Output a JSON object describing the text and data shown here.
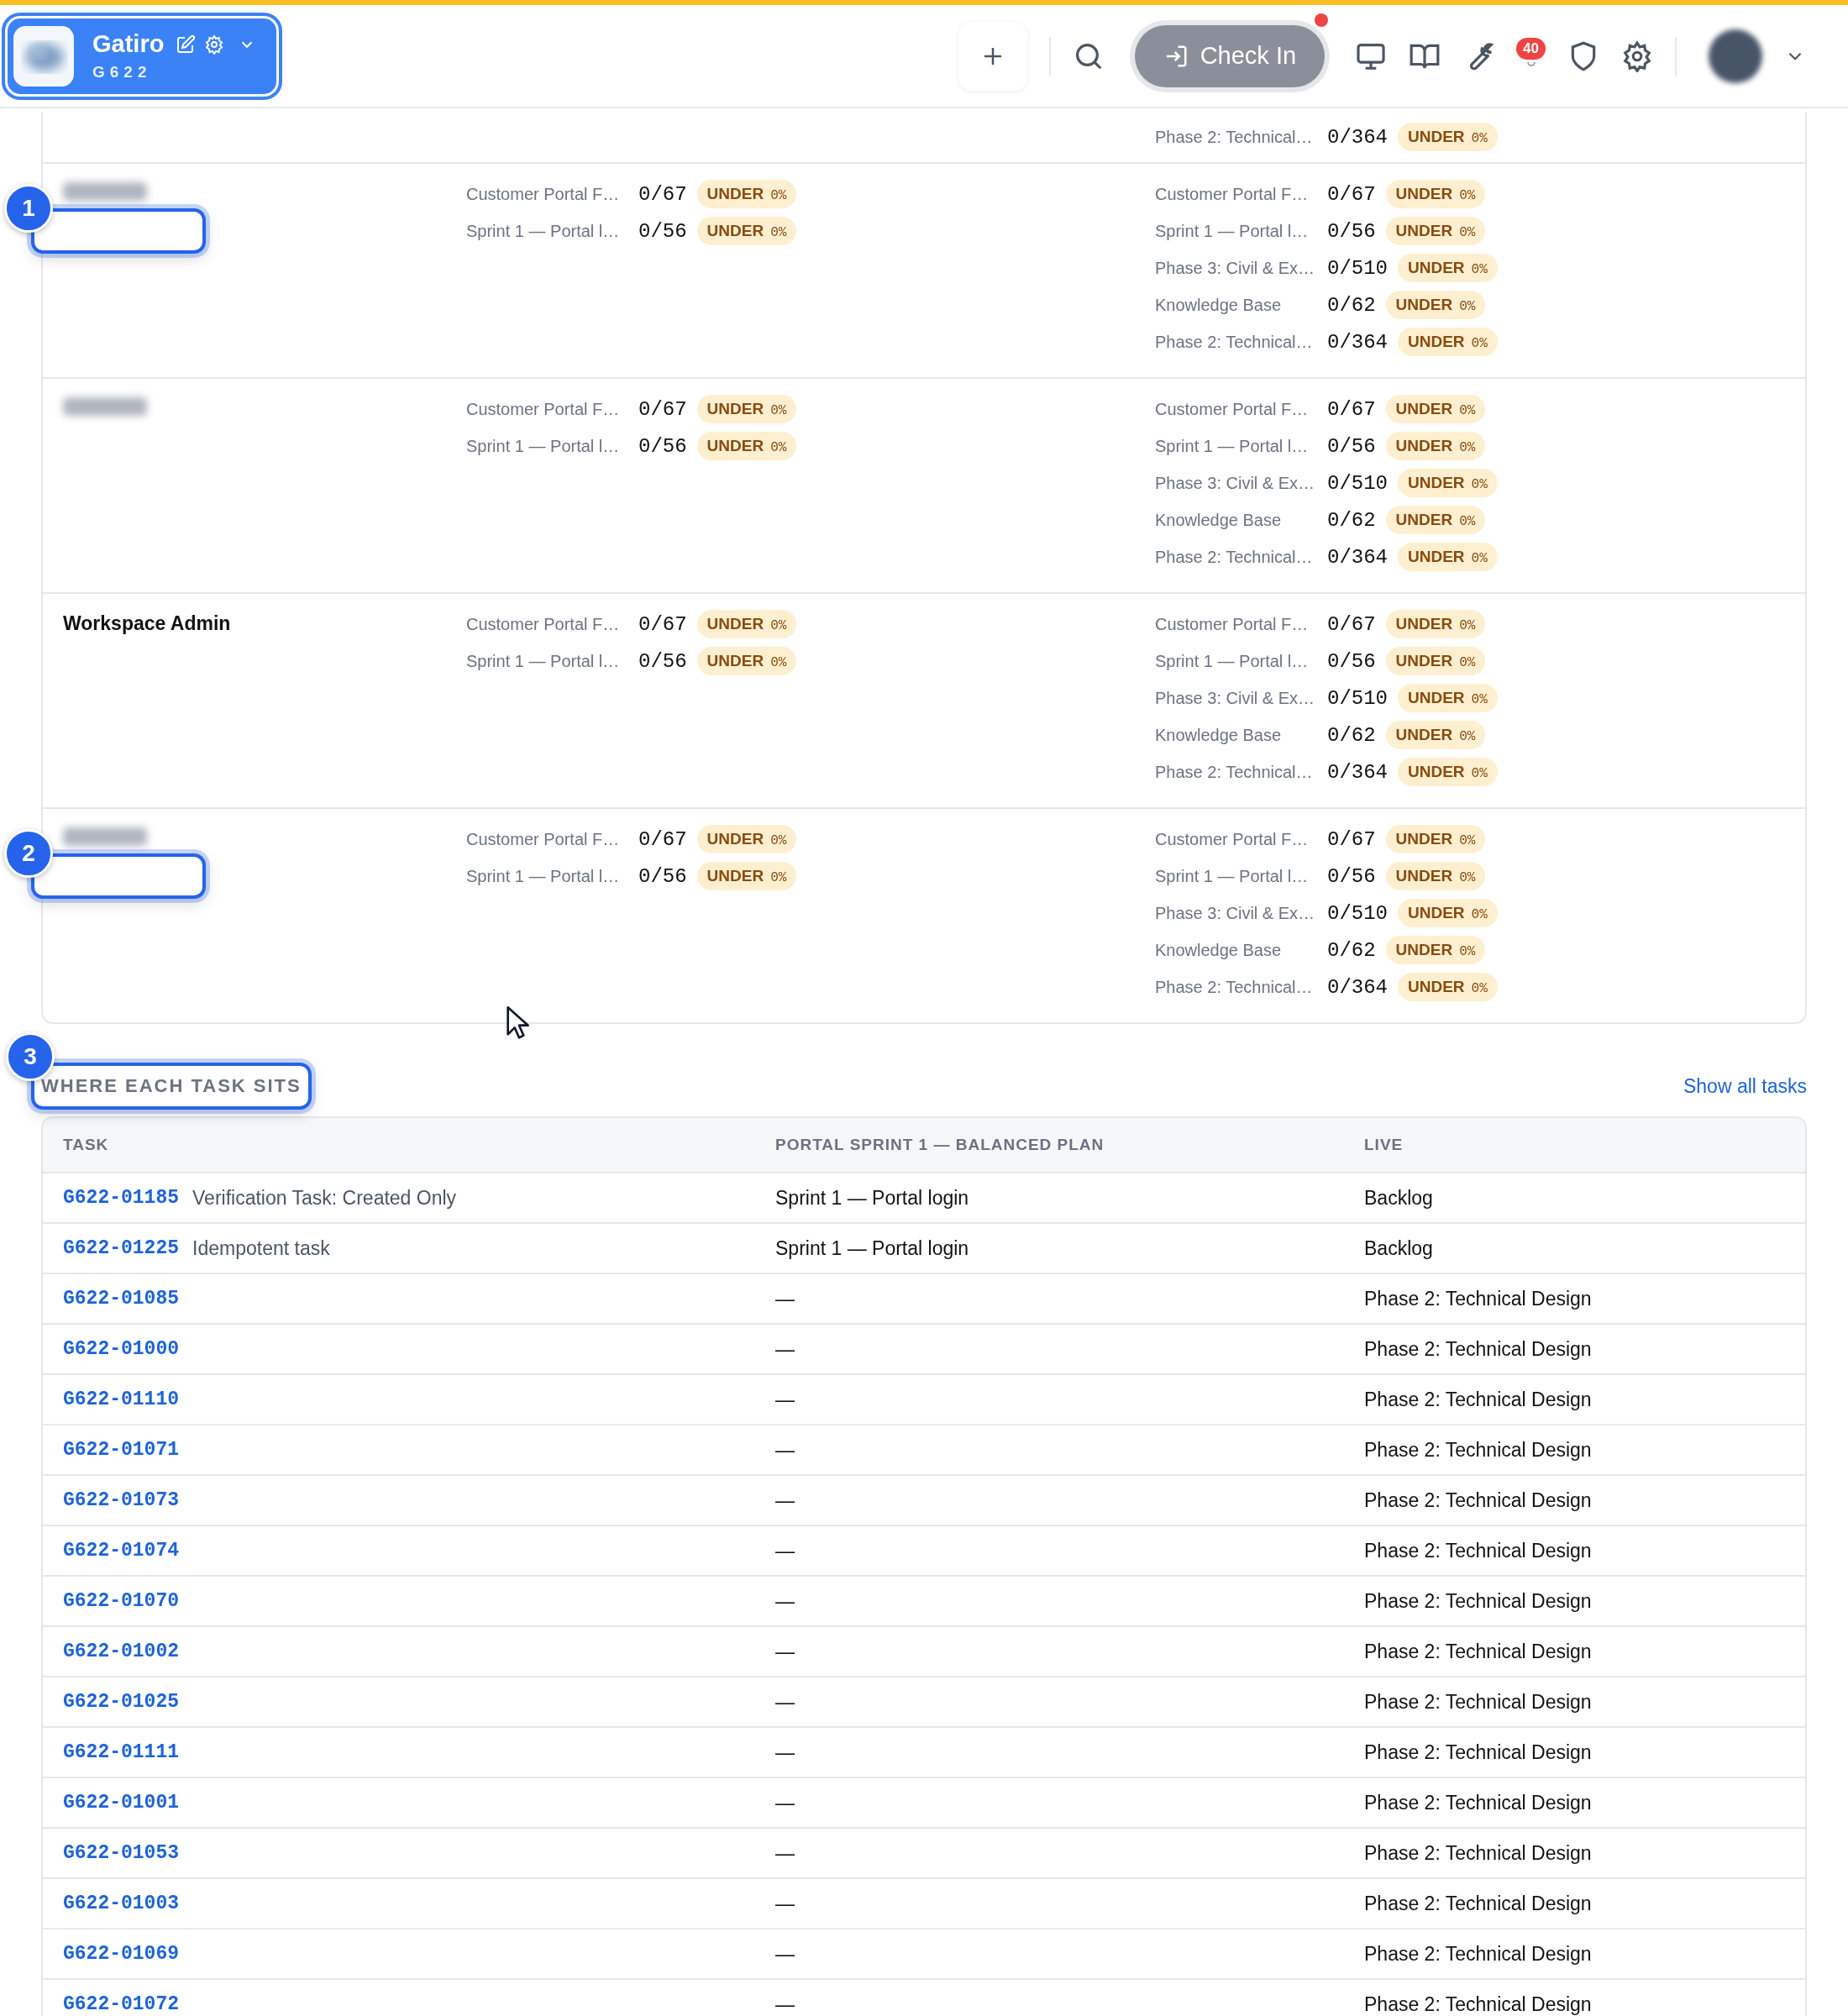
{
  "header": {
    "workspace": {
      "name": "Gatiro",
      "code": "G622"
    },
    "check_in": {
      "label": "Check In",
      "dot": true
    },
    "notifications": {
      "count": "40"
    }
  },
  "partial_row": {
    "right_metrics": [
      {
        "label": "Phase 2: Technical…",
        "value": "0/364",
        "status": "UNDER",
        "percent": "0%"
      }
    ]
  },
  "members": [
    {
      "kind": "blurred",
      "annotation": "1",
      "left_metrics": [
        {
          "label": "Customer Portal F…",
          "value": "0/67",
          "status": "UNDER",
          "percent": "0%"
        },
        {
          "label": "Sprint 1 — Portal l…",
          "value": "0/56",
          "status": "UNDER",
          "percent": "0%"
        }
      ],
      "right_metrics": [
        {
          "label": "Customer Portal F…",
          "value": "0/67",
          "status": "UNDER",
          "percent": "0%"
        },
        {
          "label": "Sprint 1 — Portal l…",
          "value": "0/56",
          "status": "UNDER",
          "percent": "0%"
        },
        {
          "label": "Phase 3: Civil & Ex…",
          "value": "0/510",
          "status": "UNDER",
          "percent": "0%"
        },
        {
          "label": "Knowledge Base",
          "value": "0/62",
          "status": "UNDER",
          "percent": "0%"
        },
        {
          "label": "Phase 2: Technical…",
          "value": "0/364",
          "status": "UNDER",
          "percent": "0%"
        }
      ]
    },
    {
      "kind": "blurred",
      "left_metrics": [
        {
          "label": "Customer Portal F…",
          "value": "0/67",
          "status": "UNDER",
          "percent": "0%"
        },
        {
          "label": "Sprint 1 — Portal l…",
          "value": "0/56",
          "status": "UNDER",
          "percent": "0%"
        }
      ],
      "right_metrics": [
        {
          "label": "Customer Portal F…",
          "value": "0/67",
          "status": "UNDER",
          "percent": "0%"
        },
        {
          "label": "Sprint 1 — Portal l…",
          "value": "0/56",
          "status": "UNDER",
          "percent": "0%"
        },
        {
          "label": "Phase 3: Civil & Ex…",
          "value": "0/510",
          "status": "UNDER",
          "percent": "0%"
        },
        {
          "label": "Knowledge Base",
          "value": "0/62",
          "status": "UNDER",
          "percent": "0%"
        },
        {
          "label": "Phase 2: Technical…",
          "value": "0/364",
          "status": "UNDER",
          "percent": "0%"
        }
      ]
    },
    {
      "kind": "named",
      "name": "Workspace Admin",
      "left_metrics": [
        {
          "label": "Customer Portal F…",
          "value": "0/67",
          "status": "UNDER",
          "percent": "0%"
        },
        {
          "label": "Sprint 1 — Portal l…",
          "value": "0/56",
          "status": "UNDER",
          "percent": "0%"
        }
      ],
      "right_metrics": [
        {
          "label": "Customer Portal F…",
          "value": "0/67",
          "status": "UNDER",
          "percent": "0%"
        },
        {
          "label": "Sprint 1 — Portal l…",
          "value": "0/56",
          "status": "UNDER",
          "percent": "0%"
        },
        {
          "label": "Phase 3: Civil & Ex…",
          "value": "0/510",
          "status": "UNDER",
          "percent": "0%"
        },
        {
          "label": "Knowledge Base",
          "value": "0/62",
          "status": "UNDER",
          "percent": "0%"
        },
        {
          "label": "Phase 2: Technical…",
          "value": "0/364",
          "status": "UNDER",
          "percent": "0%"
        }
      ]
    },
    {
      "kind": "blurred",
      "annotation": "2",
      "left_metrics": [
        {
          "label": "Customer Portal F…",
          "value": "0/67",
          "status": "UNDER",
          "percent": "0%"
        },
        {
          "label": "Sprint 1 — Portal l…",
          "value": "0/56",
          "status": "UNDER",
          "percent": "0%"
        }
      ],
      "right_metrics": [
        {
          "label": "Customer Portal F…",
          "value": "0/67",
          "status": "UNDER",
          "percent": "0%"
        },
        {
          "label": "Sprint 1 — Portal l…",
          "value": "0/56",
          "status": "UNDER",
          "percent": "0%"
        },
        {
          "label": "Phase 3: Civil & Ex…",
          "value": "0/510",
          "status": "UNDER",
          "percent": "0%"
        },
        {
          "label": "Knowledge Base",
          "value": "0/62",
          "status": "UNDER",
          "percent": "0%"
        },
        {
          "label": "Phase 2: Technical…",
          "value": "0/364",
          "status": "UNDER",
          "percent": "0%"
        }
      ]
    }
  ],
  "tasks_section": {
    "title": "WHERE EACH TASK SITS",
    "annotation": "3",
    "link": "Show all tasks",
    "table": {
      "columns": [
        "TASK",
        "PORTAL SPRINT 1 — BALANCED PLAN",
        "LIVE"
      ],
      "rows": [
        {
          "id": "G622-01185",
          "title": "Verification Task: Created Only",
          "plan": "Sprint 1 — Portal login",
          "live": "Backlog"
        },
        {
          "id": "G622-01225",
          "title": "Idempotent task",
          "plan": "Sprint 1 — Portal login",
          "live": "Backlog"
        },
        {
          "id": "G622-01085",
          "plan": "—",
          "live": "Phase 2: Technical Design"
        },
        {
          "id": "G622-01000",
          "plan": "—",
          "live": "Phase 2: Technical Design"
        },
        {
          "id": "G622-01110",
          "plan": "—",
          "live": "Phase 2: Technical Design"
        },
        {
          "id": "G622-01071",
          "plan": "—",
          "live": "Phase 2: Technical Design"
        },
        {
          "id": "G622-01073",
          "plan": "—",
          "live": "Phase 2: Technical Design"
        },
        {
          "id": "G622-01074",
          "plan": "—",
          "live": "Phase 2: Technical Design"
        },
        {
          "id": "G622-01070",
          "plan": "—",
          "live": "Phase 2: Technical Design"
        },
        {
          "id": "G622-01002",
          "plan": "—",
          "live": "Phase 2: Technical Design"
        },
        {
          "id": "G622-01025",
          "plan": "—",
          "live": "Phase 2: Technical Design"
        },
        {
          "id": "G622-01111",
          "plan": "—",
          "live": "Phase 2: Technical Design"
        },
        {
          "id": "G622-01001",
          "plan": "—",
          "live": "Phase 2: Technical Design"
        },
        {
          "id": "G622-01053",
          "plan": "—",
          "live": "Phase 2: Technical Design"
        },
        {
          "id": "G622-01003",
          "plan": "—",
          "live": "Phase 2: Technical Design"
        },
        {
          "id": "G622-01069",
          "plan": "—",
          "live": "Phase 2: Technical Design"
        },
        {
          "id": "G622-01072",
          "plan": "—",
          "live": "Phase 2: Technical Design"
        }
      ]
    }
  }
}
